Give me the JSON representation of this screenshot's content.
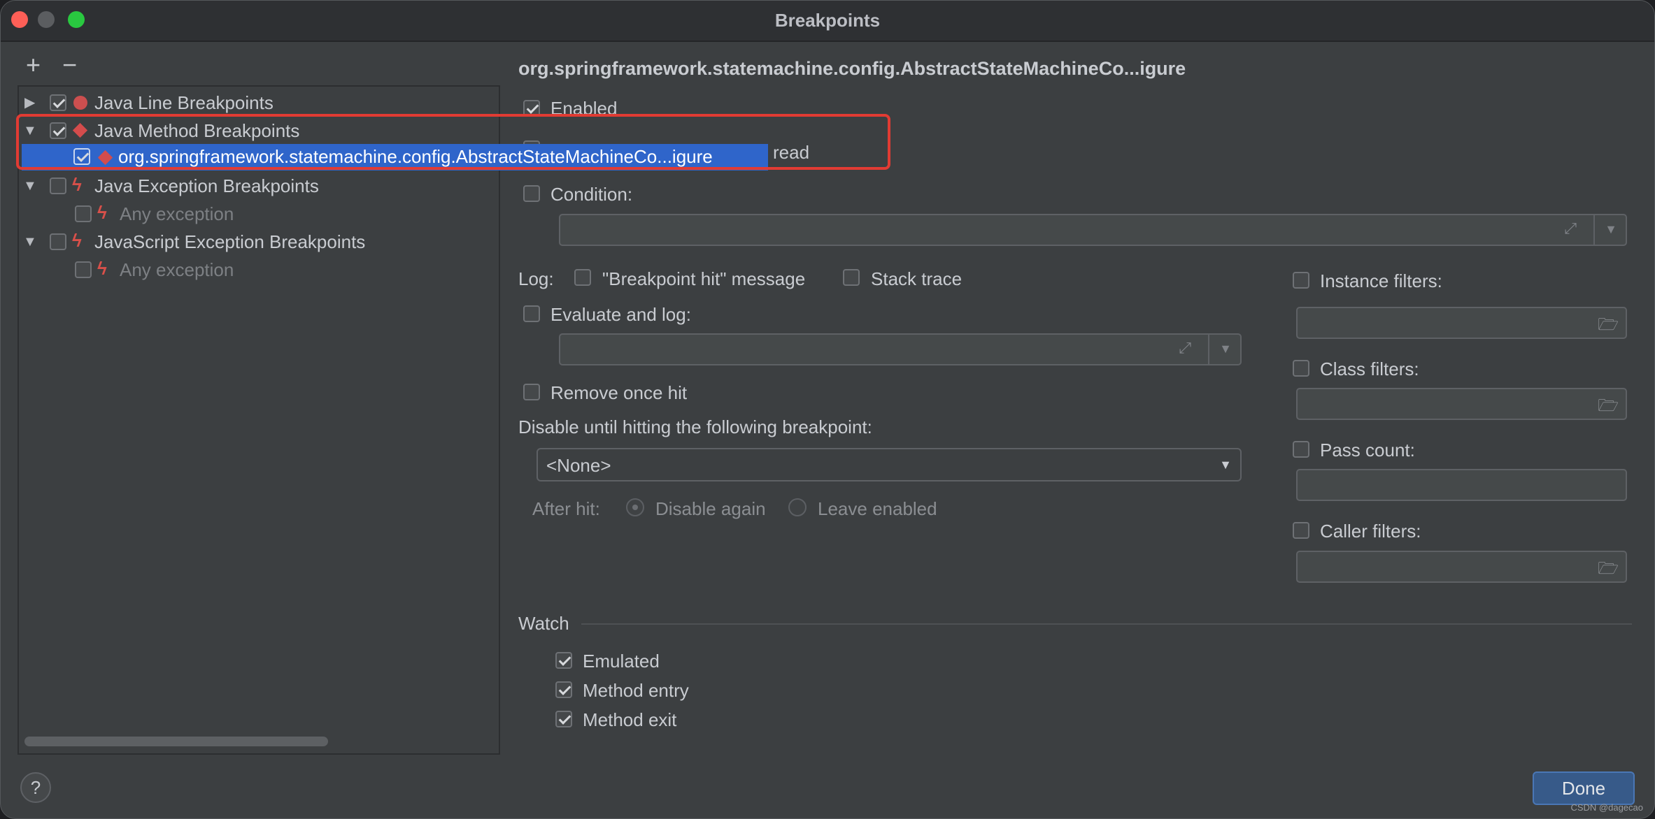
{
  "window": {
    "title": "Breakpoints"
  },
  "toolbar": {
    "add_label": "+",
    "remove_label": "−"
  },
  "tree": {
    "groups": [
      {
        "label": "Java Line Breakpoints",
        "checked": true,
        "expanded": false,
        "icon": "red-dot-icon"
      },
      {
        "label": "Java Method Breakpoints",
        "checked": true,
        "expanded": true,
        "icon": "red-diamond-icon"
      },
      {
        "label": "Java Exception Breakpoints",
        "checked": false,
        "expanded": true,
        "icon": "lightning-icon"
      },
      {
        "label": "JavaScript Exception Breakpoints",
        "checked": false,
        "expanded": true,
        "icon": "lightning-icon"
      }
    ],
    "method_child": "org.springframework.statemachine.config.AbstractStateMachineCo...igure",
    "exception_child": "Any exception",
    "js_exception_child": "Any exception"
  },
  "details": {
    "heading": "org.springframework.statemachine.config.AbstractStateMachineCo...igure",
    "enabled_label": "Enabled",
    "suspend_partial": "read",
    "condition_label": "Condition:",
    "log_label": "Log:",
    "bp_hit_label": "\"Breakpoint hit\" message",
    "stack_trace_label": "Stack trace",
    "evaluate_label": "Evaluate and log:",
    "remove_once_label": "Remove once hit",
    "disable_until_label": "Disable until hitting the following breakpoint:",
    "disable_until_value": "<None>",
    "after_hit_label": "After hit:",
    "disable_again_label": "Disable again",
    "leave_enabled_label": "Leave enabled",
    "instance_filters_label": "Instance filters:",
    "class_filters_label": "Class filters:",
    "pass_count_label": "Pass count:",
    "caller_filters_label": "Caller filters:",
    "watch_label": "Watch",
    "emulated_label": "Emulated",
    "method_entry_label": "Method entry",
    "method_exit_label": "Method exit"
  },
  "footer": {
    "help_label": "?",
    "done_label": "Done",
    "watermark": "CSDN @dagecao"
  },
  "colors": {
    "accent_selection": "#2f65ca",
    "highlight_box": "#e13b33",
    "breakpoint_red": "#cc4f4f"
  }
}
